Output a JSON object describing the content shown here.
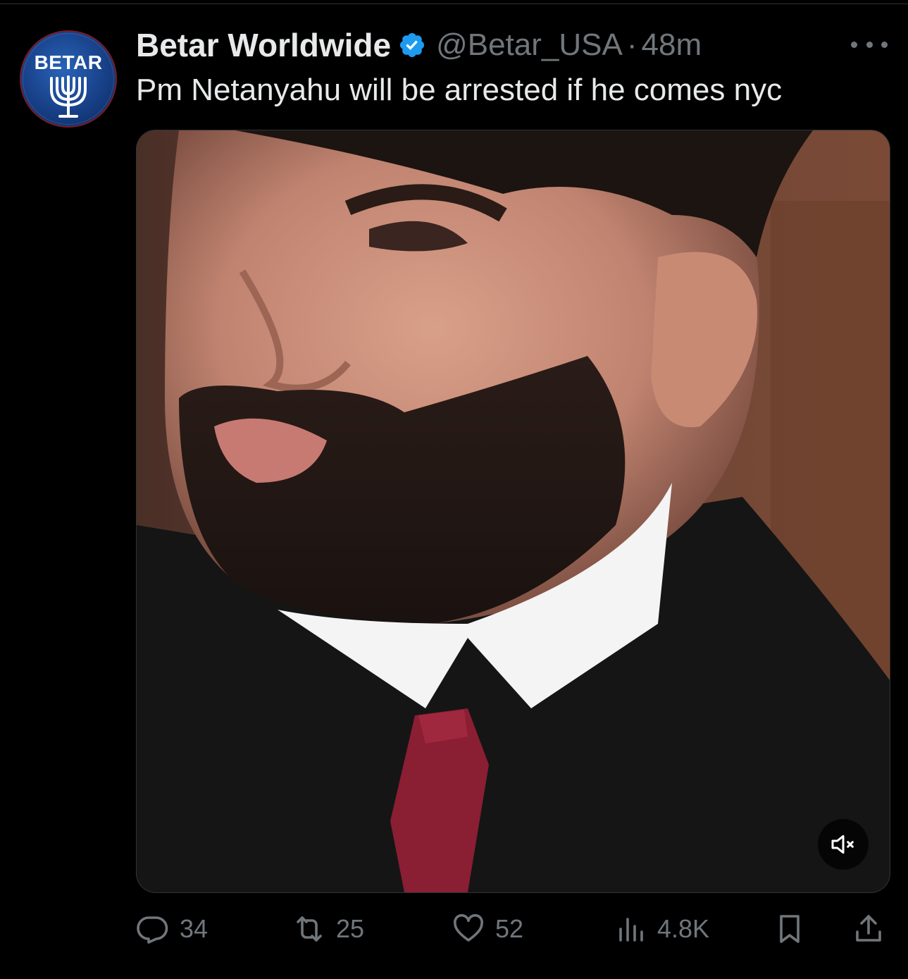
{
  "tweet": {
    "author": {
      "display_name": "Betar Worldwide",
      "handle": "@Betar_USA",
      "verified": true,
      "avatar_text": "BETAR"
    },
    "separator": "·",
    "time": "48m",
    "text": "Pm Netanyahu will be arrested if he comes nyc",
    "media": {
      "type": "video",
      "muted": true,
      "mute_icon": "speaker-muted-icon"
    },
    "actions": {
      "replies": "34",
      "reposts": "25",
      "likes": "52",
      "views": "4.8K"
    }
  },
  "colors": {
    "background": "#000000",
    "primary_text": "#e7e9ea",
    "secondary_text": "#71767b",
    "verified_badge": "#1d9bf0",
    "divider": "#2f3336"
  }
}
